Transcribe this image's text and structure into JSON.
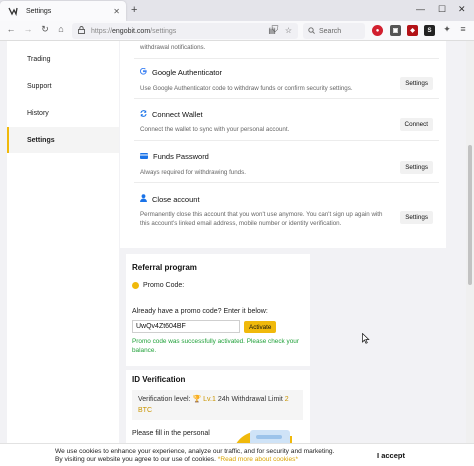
{
  "browser": {
    "tab_title": "Settings",
    "url_domain": "engobit.com",
    "url_path": "/settings",
    "url_prefix": "https://",
    "search_placeholder": "Search"
  },
  "sidebar": {
    "items": [
      {
        "label": "Trading"
      },
      {
        "label": "Support"
      },
      {
        "label": "History"
      },
      {
        "label": "Settings"
      }
    ]
  },
  "security": {
    "top_desc": "withdrawal notifications.",
    "rows": [
      {
        "title": "Google Authenticator",
        "desc": "Use Google Authenticator code to withdraw funds or confirm security settings.",
        "button": "Settings",
        "icon": "google-icon"
      },
      {
        "title": "Connect Wallet",
        "desc": "Connect the wallet to sync with your personal account.",
        "button": "Connect",
        "icon": "refresh-icon"
      },
      {
        "title": "Funds Password",
        "desc": "Always required for withdrawing funds.",
        "button": "Settings",
        "icon": "card-icon"
      },
      {
        "title": "Close account",
        "desc": "Permanently close this account that you won't use anymore. You can't sign up again with this account's linked email address, mobile number or identity verification.",
        "button": "Settings",
        "icon": "user-icon"
      }
    ]
  },
  "referral": {
    "title": "Referral program",
    "promo_label": "Promo Code:",
    "promo_question": "Already have a promo code? Enter it below:",
    "promo_value": "UwQv4Zt604BF",
    "activate_label": "Activate",
    "success_message": "Promo code was successfully activated. Please check your balance."
  },
  "id_verification": {
    "title": "ID Verification",
    "level_prefix": "Verification level:",
    "level": "Lv.1",
    "limit_text": "24h Withdrawal Limit",
    "limit_value": "2",
    "limit_unit": "BTC",
    "fill_text": "Please fill in the personal"
  },
  "cookie": {
    "line1": "We use cookies to enhance your experience, analyze our traffic, and for security and marketing.",
    "line2": "By visiting our website you agree to our use of cookies.",
    "link": "*Read more about cookies*",
    "accept": "I accept"
  },
  "colors": {
    "accent": "#f0b90b",
    "success": "#21a13a"
  }
}
